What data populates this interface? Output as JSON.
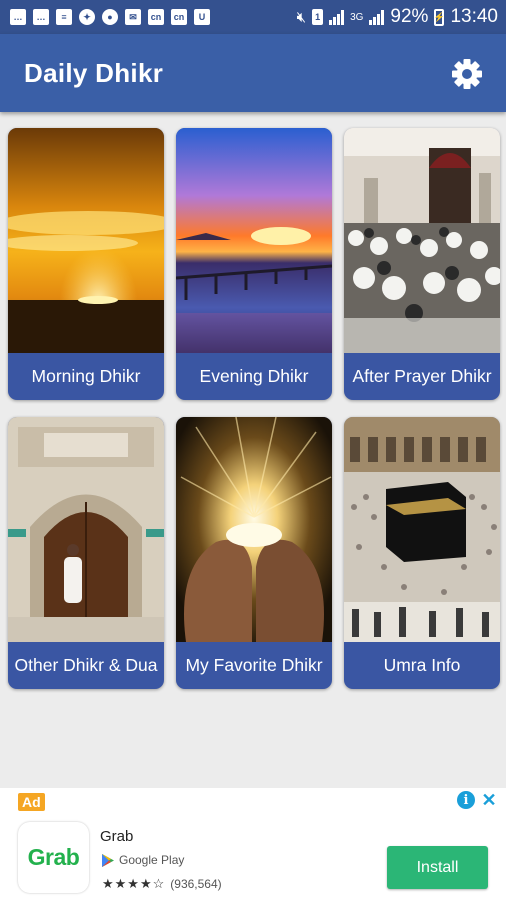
{
  "status_bar": {
    "notification_icons": [
      "message-icon",
      "message-icon",
      "document-icon",
      "app-icon",
      "location-icon",
      "mail-icon",
      "cnn-icon",
      "cnn-icon",
      "magnet-icon"
    ],
    "battery_percent": "92%",
    "time": "13:40"
  },
  "app_bar": {
    "title": "Daily Dhikr",
    "settings_icon": "gear-icon"
  },
  "tiles": [
    {
      "label": "Morning Dhikr"
    },
    {
      "label": "Evening Dhikr"
    },
    {
      "label": "After Prayer Dhikr"
    },
    {
      "label": "Other Dhikr & Dua"
    },
    {
      "label": "My Favorite Dhikr"
    },
    {
      "label": "Umra Info"
    }
  ],
  "ad": {
    "tag": "Ad",
    "app_name": "Grab",
    "logo_text": "Grab",
    "store": "Google Play",
    "stars": "★★★★☆",
    "rating_count": "(936,564)",
    "install_label": "Install",
    "accent": "#2bb676"
  },
  "colors": {
    "status_bar": "#34518f",
    "app_bar": "#3a5fa7",
    "tile_label": "#3a56a3",
    "background": "#ececec"
  }
}
